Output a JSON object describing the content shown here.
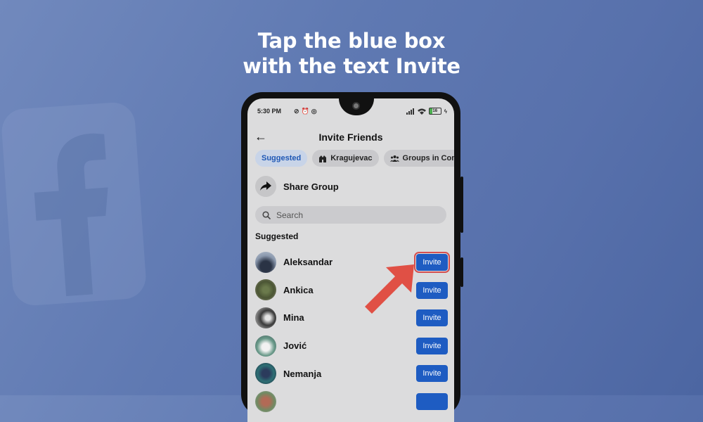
{
  "headline": {
    "line1": "Tap the blue box",
    "line2": "with the text Invite"
  },
  "status_bar": {
    "time": "5:30 PM",
    "left_icons": [
      "no-sync-icon",
      "alarm-icon",
      "instagram-icon"
    ],
    "right_icons": [
      "signal-icon",
      "wifi-icon",
      "battery-icon",
      "charging-icon"
    ],
    "battery": "16"
  },
  "header": {
    "back_icon": "arrow-left-icon",
    "title": "Invite Friends"
  },
  "chips": [
    {
      "label": "Suggested",
      "icon": null,
      "active": true
    },
    {
      "label": "Kragujevac",
      "icon": "city-icon",
      "active": false
    },
    {
      "label": "Groups in Comm",
      "icon": "groups-icon",
      "active": false
    }
  ],
  "share": {
    "label": "Share Group",
    "icon": "share-arrow-icon"
  },
  "search": {
    "placeholder": "Search",
    "value": ""
  },
  "section_title": "Suggested",
  "friends": [
    {
      "name": "Aleksandar",
      "button": "Invite",
      "highlighted": true
    },
    {
      "name": "Ankica",
      "button": "Invite",
      "highlighted": false
    },
    {
      "name": "Mina",
      "button": "Invite",
      "highlighted": false
    },
    {
      "name": "Jović",
      "button": "Invite",
      "highlighted": false
    },
    {
      "name": "Nemanja",
      "button": "Invite",
      "highlighted": false
    },
    {
      "name": "",
      "button": "",
      "highlighted": false
    }
  ],
  "colors": {
    "accent": "#1e5cc2",
    "highlight": "#d54f4f",
    "background": "#5f79b2"
  }
}
